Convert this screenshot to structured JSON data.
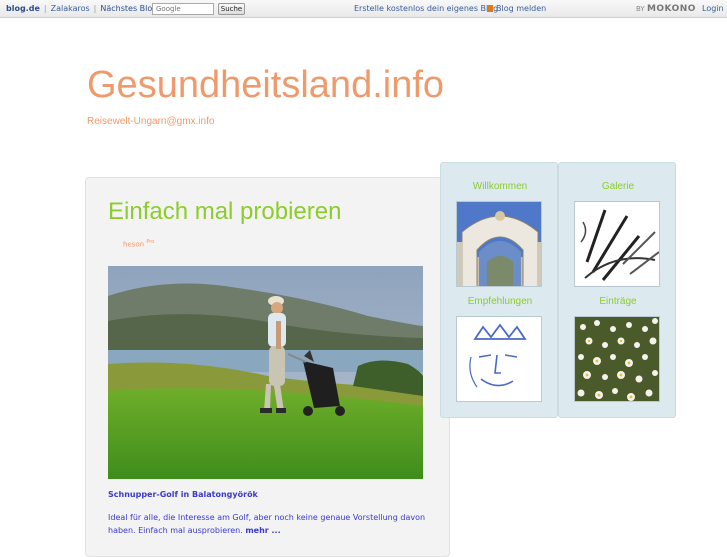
{
  "topbar": {
    "brand": "blog.de",
    "current_blog": "Zalakaros",
    "next_blog": "Nächstes Blog »",
    "search_placeholder": "Google",
    "search_button": "Suche",
    "create_blog": "Erstelle kostenlos dein eigenes Blog",
    "report_blog": "Blog melden",
    "by_label": "BY",
    "provider": "MOKONO",
    "login": "Login"
  },
  "site": {
    "title": "Gesundheitsland.info",
    "subtitle": "Reisewelt-Ungarn@gmx.info"
  },
  "post": {
    "title": "Einfach mal probieren",
    "author": "heson",
    "author_badge": "Pro",
    "heading": "Schnupper-Golf in Balatongyörök",
    "text": "Ideal für alle, die Interesse am Golf, aber noch keine genaue Vorstellung davon haben. Einfach mal ausprobieren.",
    "more_link": "mehr ..."
  },
  "sidebar": {
    "widgets": [
      {
        "label": "Willkommen",
        "icon": "palace-gate-photo"
      },
      {
        "label": "Galerie",
        "icon": "sketch-drawing"
      },
      {
        "label": "Empfehlungen",
        "icon": "crowned-face-sketch"
      },
      {
        "label": "Einträge",
        "icon": "daisy-field-photo"
      }
    ]
  },
  "colors": {
    "title": "#ef9a6d",
    "accent_green": "#8ccc2c",
    "link_blue": "#3a3acc",
    "sidebar_bg": "#dce9ef"
  }
}
